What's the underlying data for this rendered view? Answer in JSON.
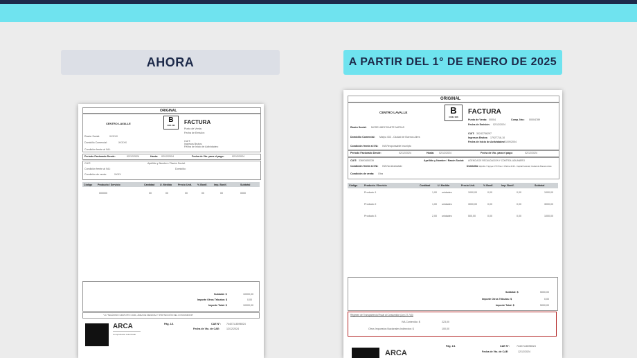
{
  "banner": {
    "now_label": "AHORA",
    "new_label": "A PARTIR DEL 1° DE ENERO DE 2025"
  },
  "doc_now": {
    "original": "ORIGINAL",
    "company": "CENTRO LAVALLE",
    "letter": "B",
    "letter_code": "COD. 006",
    "title": "FACTURA",
    "right_fields": [
      "Punto de Venta:",
      "Fecha de Emisión:",
      "CUIT:",
      "Ingresos Brutos:",
      "Fecha de Inicio de Actividades:"
    ],
    "left_fields": [
      "Razón Social:",
      "Domicilio Comercial:",
      "Condición frente al IVA:"
    ],
    "left_values": [
      "XXXXX",
      "XXXXX"
    ],
    "period": {
      "from_label": "Período Facturado Desde:",
      "from": "02/12/2024",
      "to_label": "Hasta:",
      "to": "02/12/2024",
      "due_label": "Fecha de Vto. para el pago:",
      "due": "02/12/2024"
    },
    "client": {
      "cuit_label": "CUIT:",
      "name_label": "Apellido y Nombre / Razón Social:",
      "iva_label": "Condición frente al IVA:",
      "sale_label": "Condición de venta:",
      "sale_value": "XXXX",
      "addr_label": "Domicilio:"
    },
    "table_headers": [
      "Código",
      "Producto / Servicio",
      "Cantidad",
      "U. Medida",
      "Precio Unit.",
      "% Bonif.",
      "Imp. Bonif.",
      "Subtotal"
    ],
    "row": [
      "",
      "000000",
      "00",
      "00",
      "00",
      "00",
      "00",
      "0000"
    ],
    "totals": [
      {
        "label": "Subtotal: $",
        "value": "10000,00"
      },
      {
        "label": "Importe Otros Tributos: $",
        "value": "0,00"
      },
      {
        "label": "Importe Total: $",
        "value": "10000,00"
      }
    ],
    "footer_note": "\"LA \"TELÉFONO GRATUITO CABA, ÁREA DE DEFENSA Y PROTECCIÓN DEL CONSUMIDOR\"",
    "arca": "ARCA",
    "arca_sub": "Comprobante Autorizado",
    "page": "Pág. 1/1",
    "cae_label": "CAE N°:",
    "cae": "74407118098024",
    "cae_due_label": "Fecha de Vto. de CAE:",
    "cae_due": "12/12/2024"
  },
  "doc_new": {
    "original": "ORIGINAL",
    "company": "CENTRO LAVALLE",
    "letter": "B",
    "letter_code": "COD. 006",
    "title": "FACTURA",
    "pv_label": "Punto de Venta:",
    "pv": "00004",
    "comp_label": "Comp. Nro:",
    "comp": "00004789",
    "emision_label": "Fecha de Emisión:",
    "emision": "02/12/2024",
    "cuit_label": "CUIT:",
    "cuit": "30242756297",
    "iibb_label": "Ingresos Brutos:",
    "iibb": "17927716-10",
    "inicio_label": "Fecha de Inicio de Actividades:",
    "inicio": "01/09/2004",
    "razon_label": "Razón Social:",
    "razon": "MOSELINEZ DANTE MATIAS",
    "domicilio_label": "Domicilio Comercial:",
    "domicilio": "Maipu 433 - Ciudad de Buenos Aires",
    "iva_label": "Condición frente al IVA:",
    "iva": "IVA Responsable Inscripto",
    "period": {
      "from_label": "Período Facturado Desde:",
      "from": "02/12/2024",
      "to_label": "Hasta:",
      "to": "02/12/2024",
      "due_label": "Fecha de Vto. para el pago:",
      "due": "02/12/2024"
    },
    "client": {
      "cuit_label": "CUIT:",
      "cuit": "33693450239",
      "name_label": "Apellido y Nombre / Razón Social:",
      "name": "AGENCIA DE RECAUDACION Y CONTROL ADUANERO",
      "iva_label": "Condición frente al IVA:",
      "iva": "IVA No Alcanzado",
      "addr_label": "Domicilio:",
      "addr": "Hipólito Yrigoyen 370 Piso 4 Oficina 4136 - Capital Federal, Ciudad de Buenos Aires",
      "sale_label": "Condición de venta:",
      "sale": "Otra"
    },
    "table_headers": [
      "Código",
      "Producto / Servicio",
      "Cantidad",
      "U. Medida",
      "Precio Unit.",
      "% Bonif.",
      "Imp. Bonif.",
      "Subtotal"
    ],
    "rows": [
      [
        "",
        "Producto 1",
        "1,00",
        "unidades",
        "1000,00",
        "0,00",
        "0,00",
        "1000,00"
      ],
      [
        "",
        "Producto 2",
        "1,00",
        "unidades",
        "3000,00",
        "0,00",
        "0,00",
        "3000,00"
      ],
      [
        "",
        "Producto 3",
        "2,00",
        "unidades",
        "500,00",
        "0,00",
        "0,00",
        "1000,00"
      ]
    ],
    "totals": [
      {
        "label": "Subtotal: $",
        "value": "5000,00"
      },
      {
        "label": "Importe Otros Tributos: $",
        "value": "0,00"
      },
      {
        "label": "Importe Total: $",
        "value": "5000,00"
      }
    ],
    "regime_title": "Régimen de Transparencia Fiscal al Consumidor (Ley 27.743)",
    "regime_rows": [
      {
        "label": "IVA Contenido: $",
        "value": "223,00"
      },
      {
        "label": "Otros Impuestos Nacionales Indirectos: $",
        "value": "100,00"
      }
    ],
    "arca": "ARCA",
    "page": "Pág. 1/1",
    "cae_label": "CAE N°:",
    "cae": "74407118098024",
    "cae_due_label": "Fecha de Vto. de CAE:",
    "cae_due": "12/12/2024"
  },
  "colors": {
    "navy": "#1d2a4a",
    "cyan": "#6fe3ef",
    "grey_pill": "#dcdfe6",
    "highlight": "#b22222"
  }
}
